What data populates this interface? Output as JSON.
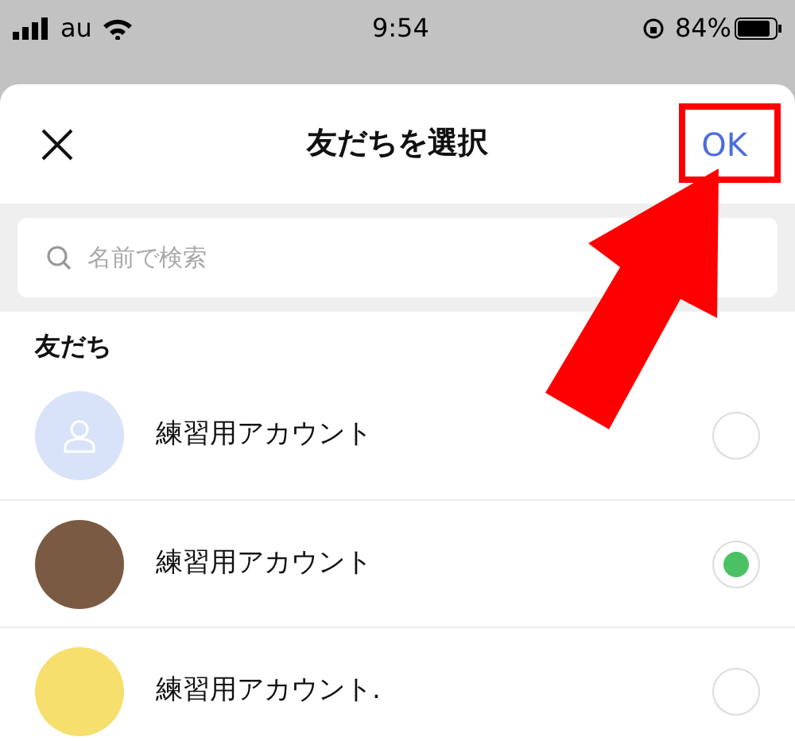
{
  "status_bar": {
    "carrier": "au",
    "time": "9:54",
    "battery": "84%"
  },
  "dialog": {
    "title": "友だちを選択",
    "ok": "OK",
    "ok_highlighted": true
  },
  "search": {
    "placeholder": "名前で検索"
  },
  "section": "友だち",
  "friends": [
    {
      "name": "練習用アカウント",
      "kind": "default",
      "color": "#d8e2f8",
      "selected": false
    },
    {
      "name": "練習用アカウント",
      "kind": "plain",
      "color": "#7a5a43",
      "selected": true
    },
    {
      "name": "練習用アカウント.",
      "kind": "plain",
      "color": "#f6df6d",
      "selected": false
    }
  ]
}
